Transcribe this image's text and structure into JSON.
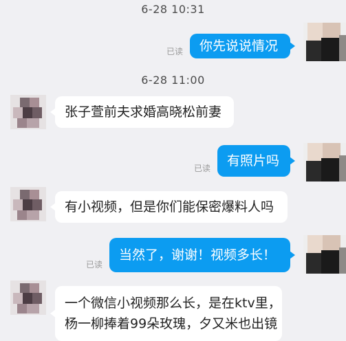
{
  "colors": {
    "background": "#f0f0f3",
    "outgoing_bubble": "#0c9cf1",
    "incoming_bubble": "#ffffff",
    "read_text": "#9a9a9a"
  },
  "chat": {
    "timestamp_1": "6-28 10:31",
    "msg_1": {
      "text": "你先说说情况",
      "status": "已读"
    },
    "timestamp_2": "6-28 11:00",
    "msg_2": {
      "text": "张子萱前夫求婚高晓松前妻"
    },
    "msg_3": {
      "text": "有照片吗",
      "status": "已读"
    },
    "msg_4": {
      "text": "有小视频，但是你们能保密爆料人吗"
    },
    "msg_5": {
      "text": "当然了，谢谢！视频多长！",
      "status": "已读"
    },
    "msg_6": {
      "line_1": "一个微信小视频那么长，是在ktv里，",
      "line_2": "杨一柳捧着99朵玫瑰，夕又米也出镜"
    }
  },
  "avatars": {
    "self": "pixelated-avatar-self",
    "contact": "pixelated-avatar-contact"
  }
}
